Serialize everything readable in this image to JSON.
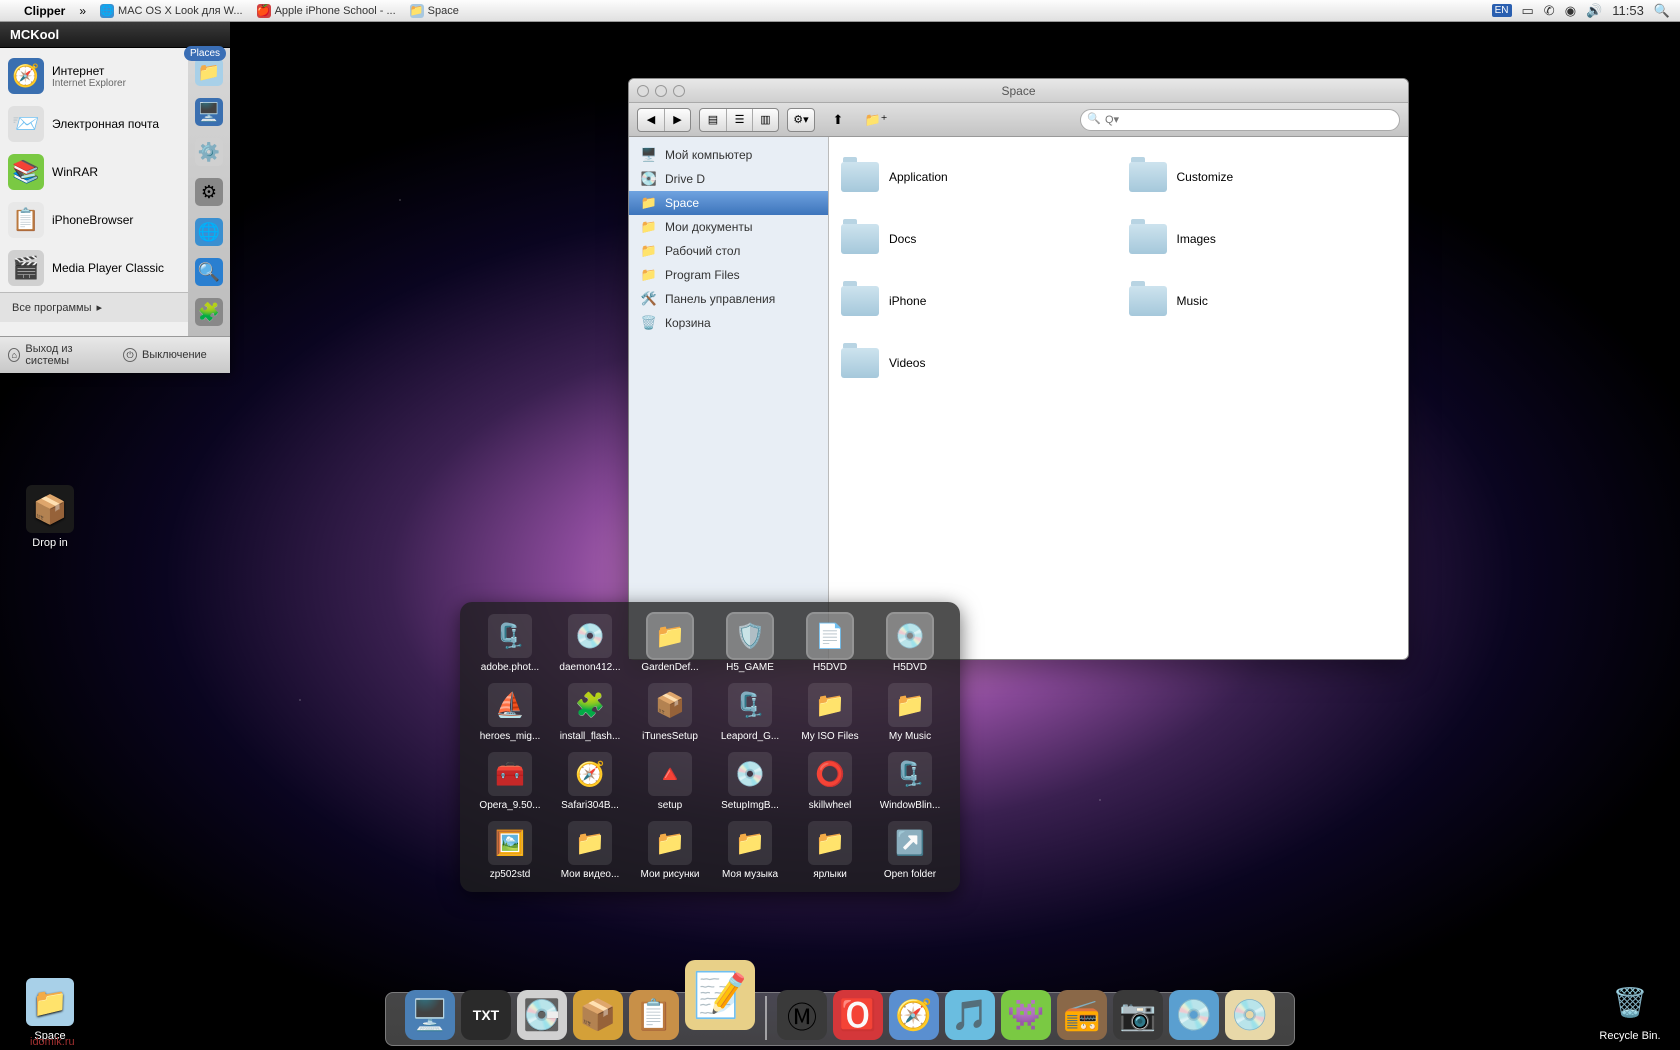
{
  "menubar": {
    "appname": "Clipper",
    "tabs": [
      {
        "label": "MAC OS X Look для W...",
        "icon": "🌐"
      },
      {
        "label": "Apple iPhone School - ...",
        "icon": "🍎"
      },
      {
        "label": "Space",
        "icon": "📁"
      }
    ],
    "lang": "EN",
    "time": "11:53"
  },
  "startmenu": {
    "title": "MCKool",
    "places_label": "Places",
    "items": [
      {
        "title": "Интернет",
        "subtitle": "Internet Explorer",
        "icon": "🧭",
        "bg": "#3a6fb0"
      },
      {
        "title": "Электронная почта",
        "subtitle": "",
        "icon": "✉️",
        "bg": "#e0e0e0"
      },
      {
        "title": "WinRAR",
        "subtitle": "",
        "icon": "📚",
        "bg": "#7ac943"
      },
      {
        "title": "iPhoneBrowser",
        "subtitle": "",
        "icon": "📱",
        "bg": "#e8e8e8"
      },
      {
        "title": "Media Player Classic",
        "subtitle": "",
        "icon": "🎬",
        "bg": "#d0d0d0"
      }
    ],
    "right_icons": [
      "📁",
      "🖥️",
      "⚙️",
      "🌍",
      "🌐",
      "🔍",
      "🧩"
    ],
    "all_programs": "Все программы",
    "logout": "Выход из системы",
    "shutdown": "Выключение"
  },
  "finder": {
    "title": "Space",
    "search_placeholder": "Q▾",
    "sidebar": [
      {
        "label": "Мой компьютер",
        "icon": "🖥️"
      },
      {
        "label": "Drive D",
        "icon": "💽"
      },
      {
        "label": "Space",
        "icon": "📁",
        "selected": true
      },
      {
        "label": "Мои документы",
        "icon": "📁"
      },
      {
        "label": "Рабочий стол",
        "icon": "📁"
      },
      {
        "label": "Program Files",
        "icon": "📁"
      },
      {
        "label": "Панель управления",
        "icon": "🛠️"
      },
      {
        "label": "Корзина",
        "icon": "🗑️"
      }
    ],
    "folders": [
      "Application",
      "Customize",
      "Docs",
      "Images",
      "iPhone",
      "Music",
      "Videos"
    ]
  },
  "desktop": {
    "dropin": "Drop in",
    "space": "Space",
    "recycle": "Recycle Bin."
  },
  "stack": [
    {
      "label": "adobe.phot...",
      "icon": "🗜️"
    },
    {
      "label": "daemon412...",
      "icon": "💿"
    },
    {
      "label": "GardenDef...",
      "icon": "📁",
      "sel": true
    },
    {
      "label": "H5_GAME",
      "icon": "🛡️",
      "sel": true
    },
    {
      "label": "H5DVD",
      "icon": "📄",
      "sel": true
    },
    {
      "label": "H5DVD",
      "icon": "💿",
      "sel": true
    },
    {
      "label": "heroes_mig...",
      "icon": "⛵"
    },
    {
      "label": "install_flash...",
      "icon": "🧩"
    },
    {
      "label": "iTunesSetup",
      "icon": "📦"
    },
    {
      "label": "Leapord_G...",
      "icon": "🗜️"
    },
    {
      "label": "My ISO Files",
      "icon": "📁"
    },
    {
      "label": "My Music",
      "icon": "📁"
    },
    {
      "label": "Opera_9.50...",
      "icon": "🧰"
    },
    {
      "label": "Safari304B...",
      "icon": "🧭"
    },
    {
      "label": "setup",
      "icon": "🔺"
    },
    {
      "label": "SetupImgB...",
      "icon": "💿"
    },
    {
      "label": "skillwheel",
      "icon": "⭕"
    },
    {
      "label": "WindowBlin...",
      "icon": "🗜️"
    },
    {
      "label": "zp502std",
      "icon": "🖼️"
    },
    {
      "label": "Мои видео...",
      "icon": "📁"
    },
    {
      "label": "Мои рисунки",
      "icon": "📁"
    },
    {
      "label": "Моя музыка",
      "icon": "📁"
    },
    {
      "label": "ярлыки",
      "icon": "📁"
    },
    {
      "label": "Open folder",
      "icon": "↗️"
    }
  ],
  "dock": [
    {
      "icon": "🖥️",
      "bg": "#4a7fb5"
    },
    {
      "icon": "TXT",
      "bg": "#2a2a2a",
      "text": true
    },
    {
      "icon": "💽",
      "bg": "#d0d0d0"
    },
    {
      "icon": "📦",
      "bg": "#d4a038"
    },
    {
      "icon": "📋",
      "bg": "#c89048"
    },
    {
      "icon": "📝",
      "bg": "#e8d088",
      "big": true
    },
    {
      "sep": true
    },
    {
      "icon": "Ⓜ",
      "bg": "#3a3a3a"
    },
    {
      "icon": "🅾️",
      "bg": "#d4373a"
    },
    {
      "icon": "🧭",
      "bg": "#5a8fd0"
    },
    {
      "icon": "🎵",
      "bg": "#6abde0"
    },
    {
      "icon": "👾",
      "bg": "#7ac943"
    },
    {
      "icon": "📻",
      "bg": "#8a6848"
    },
    {
      "icon": "📷",
      "bg": "#3a3a3a"
    },
    {
      "icon": "💿",
      "bg": "#5a9fd0"
    },
    {
      "icon": "💿",
      "bg": "#e8d8a8"
    }
  ],
  "watermark": "idomik.ru"
}
